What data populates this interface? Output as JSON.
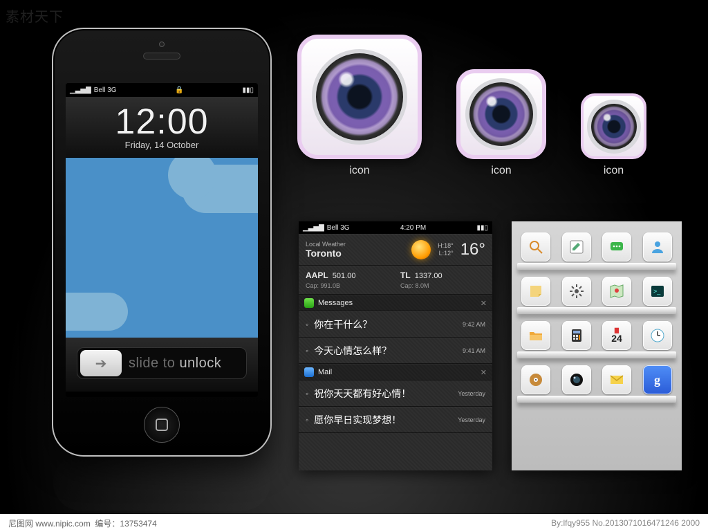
{
  "watermark": {
    "topLeft": "素材天下",
    "siteLabel": "尼图网 www.nipic.com",
    "idLabel": "编号：",
    "id": "13753474",
    "by": "By:lfqy955  No.2013071016471246 2000"
  },
  "phone": {
    "status": {
      "carrier": "Bell 3G",
      "signal": "▁▃▅▇",
      "lockGlyph": "🔒",
      "batteryGlyph": "▮▮▯"
    },
    "clock": "12:00",
    "date": "Friday, 14 October",
    "slidePrefix": "slide to ",
    "slideWord": "unlock",
    "arrow": "➔"
  },
  "cameraIcons": {
    "label": "icon"
  },
  "nc": {
    "status": {
      "carrier": "Bell 3G",
      "time": "4:20 PM"
    },
    "weather": {
      "localLabel": "Local Weather",
      "city": "Toronto",
      "hi": "H:18°",
      "lo": "L:12°",
      "temp": "16°"
    },
    "stocks": [
      {
        "sym": "AAPL",
        "price": "501.00",
        "cap": "Cap: 991.0B"
      },
      {
        "sym": "TL",
        "price": "1337.00",
        "cap": "Cap: 8.0M"
      }
    ],
    "messagesHeader": "Messages",
    "messages": [
      {
        "text": "你在干什么？",
        "time": "9:42 AM"
      },
      {
        "text": "今天心情怎么样？",
        "time": "9:41 AM"
      }
    ],
    "mailHeader": "Mail",
    "mails": [
      {
        "text": "祝你天天都有好心情！",
        "time": "Yesterday"
      },
      {
        "text": "愿你早日实现梦想！",
        "time": "Yesterday"
      }
    ]
  },
  "home": {
    "apps": [
      [
        "search",
        "notes-pencil",
        "chat",
        "contact"
      ],
      [
        "sticky-notes",
        "settings-gear",
        "maps-pin",
        "terminal"
      ],
      [
        "files",
        "calculator",
        "calendar-24",
        "clock"
      ],
      [
        "music-disc",
        "camera",
        "mail-envelope",
        "google-g"
      ]
    ],
    "calDay": "24"
  }
}
